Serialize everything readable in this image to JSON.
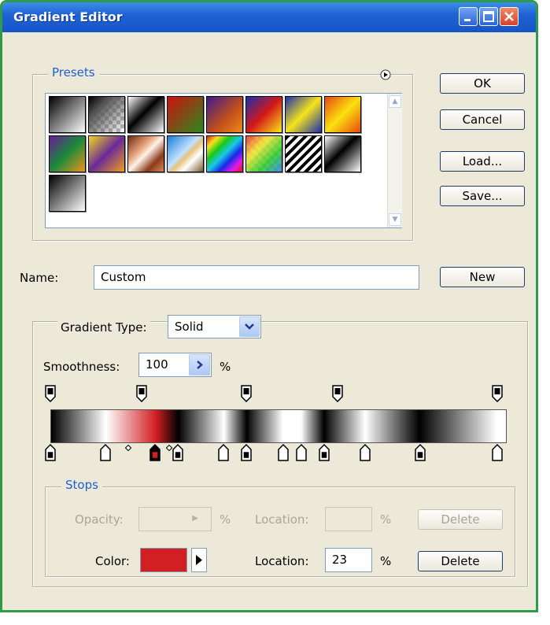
{
  "window": {
    "title": "Gradient Editor"
  },
  "presets": {
    "legend": "Presets",
    "swatches": [
      {
        "name": "black-white",
        "bg": "linear-gradient(135deg,#000 0%,#fff 100%)"
      },
      {
        "name": "black-transparent",
        "bg": "linear-gradient(135deg,#000 0%,#555 30%, transparent 100%), repeating-conic-gradient(#bbb 0 25%, #fff 0 50%) 0 0/10px 10px"
      },
      {
        "name": "black-white-2",
        "bg": "linear-gradient(135deg,#fff 0%,#000 45%,#fff 100%)"
      },
      {
        "name": "red-green",
        "bg": "linear-gradient(135deg,#d01010 0%,#2a8a1c 100%)"
      },
      {
        "name": "violet-orange",
        "bg": "linear-gradient(135deg,#3d1a8c 0%,#c4521a 60%,#f08a1a 100%)"
      },
      {
        "name": "blue-red-yellow",
        "bg": "linear-gradient(135deg,#1a2fb0 0%,#d41818 50%,#f7e81a 100%)"
      },
      {
        "name": "blue-yellow-blue",
        "bg": "linear-gradient(135deg,#1a2fb0 0%,#f5e41a 50%,#1a2fb0 100%)"
      },
      {
        "name": "orange-yellow-orange",
        "bg": "linear-gradient(135deg,#e84a0c 0%,#fbe010 50%,#e84a0c 100%)"
      },
      {
        "name": "violet-green-orange",
        "bg": "linear-gradient(135deg,#6a1a9a 0%,#1a8a3a 50%,#f2921a 100%)"
      },
      {
        "name": "yellow-violet-orange",
        "bg": "linear-gradient(135deg,#f5d81a 0%,#6a2a9a 50%,#f0a01a 100%)"
      },
      {
        "name": "copper",
        "bg": "linear-gradient(135deg,#6b2a10 0%,#e8a47c 35%,#fff3e8 50%,#8a3a18 75%,#d88a5a 100%)"
      },
      {
        "name": "chrome",
        "bg": "linear-gradient(135deg,#1a7ad8 0%,#bfe2ff 45%,#e8c27a 55%,#fff 70%,#7a5a2a 100%)"
      },
      {
        "name": "spectrum",
        "bg": "linear-gradient(135deg,#e81818,#f5e41a,#18c818,#18c8e8,#1828e8,#e818e8,#e81818)"
      },
      {
        "name": "transparent-rainbow",
        "bg": "linear-gradient(135deg,rgba(232,24,24,.8),rgba(245,228,26,.8),rgba(24,200,24,.8),rgba(24,120,232,.8)), repeating-conic-gradient(#ccc 0 25%, #fff 0 50%) 0 0/10px 10px"
      },
      {
        "name": "transparent-stripes",
        "bg": "repeating-linear-gradient(135deg,#000 0 4px,#fff 4px 8px)"
      },
      {
        "name": "black-white-3",
        "bg": "linear-gradient(135deg,#fff 0%,#000 45%,#fff 100%)"
      },
      {
        "name": "black-white-4",
        "bg": "linear-gradient(135deg,#000 0%,#fff 100%)"
      }
    ]
  },
  "buttons": {
    "ok": "OK",
    "cancel": "Cancel",
    "load": "Load...",
    "save": "Save...",
    "new": "New"
  },
  "name_field": {
    "label": "Name:",
    "value": "Custom"
  },
  "gradient": {
    "type_label": "Gradient Type:",
    "type_value": "Solid",
    "smoothness_label": "Smoothness:",
    "smoothness_value": "100",
    "smoothness_unit": "%",
    "opacity_stops_pct": [
      0,
      20,
      43,
      63,
      98
    ],
    "color_stops": [
      {
        "pos": 0,
        "color": "#000000"
      },
      {
        "pos": 12,
        "color": "#ffffff"
      },
      {
        "pos": 23,
        "color": "#d21f24"
      },
      {
        "pos": 28,
        "color": "#000000"
      },
      {
        "pos": 38,
        "color": "#ffffff"
      },
      {
        "pos": 43,
        "color": "#000000"
      },
      {
        "pos": 51,
        "color": "#ffffff"
      },
      {
        "pos": 55,
        "color": "#ffffff"
      },
      {
        "pos": 60,
        "color": "#000000"
      },
      {
        "pos": 69,
        "color": "#ffffff"
      },
      {
        "pos": 81,
        "color": "#000000"
      },
      {
        "pos": 98,
        "color": "#ffffff"
      }
    ],
    "color_midpoints_pct": [
      17,
      26
    ],
    "selected_color_stop": 2
  },
  "stops": {
    "legend": "Stops",
    "opacity_label": "Opacity:",
    "opacity_unit": "%",
    "opacity_location_label": "Location:",
    "opacity_location_unit": "%",
    "opacity_delete": "Delete",
    "color_label": "Color:",
    "color_value": "#d21f24",
    "color_location_label": "Location:",
    "color_location_value": "23",
    "color_location_unit": "%",
    "color_delete": "Delete"
  },
  "icons": {
    "presets_menu": "circle-arrow-icon",
    "smoothness_arrow": "arrow-right-icon",
    "type_dropdown": "chevron-down-icon",
    "color_menu": "triangle-right-icon"
  }
}
